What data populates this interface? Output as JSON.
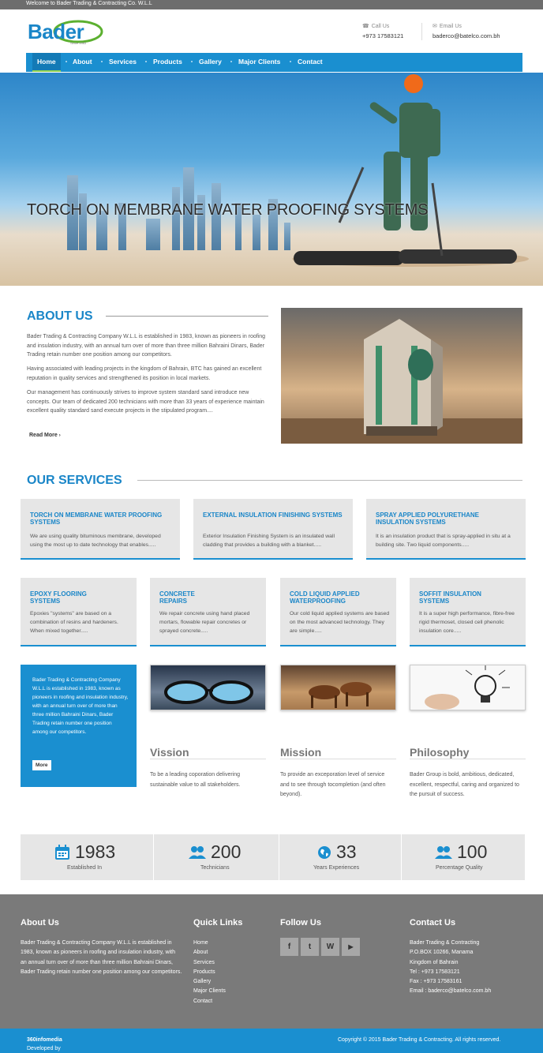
{
  "topbar": {
    "welcome": "Welcome to Bader Trading & Contracting Co. W.L.L"
  },
  "header": {
    "logo_text": "Bader",
    "logo_since": "Since 1983",
    "call_label": "Call Us",
    "call_value": "+973 17583121",
    "email_label": "Email Us",
    "email_value": "baderco@batelco.com.bh"
  },
  "nav": {
    "items": [
      "Home",
      "About",
      "Services",
      "Products",
      "Gallery",
      "Major Clients",
      "Contact"
    ]
  },
  "hero": {
    "title": "TORCH ON MEMBRANE WATER PROOFING SYSTEMS"
  },
  "about": {
    "title": "ABOUT US",
    "p1": "Bader Trading & Contracting Company W.L.L is established in 1983, known as pioneers in roofing and insulation industry, with an annual turn over of more than three million Bahraini Dinars, Bader Trading retain number one position among our competitors.",
    "p2": "Having associated with leading projects in the kingdom of Bahrain, BTC has gained an excellent reputation in quality services and strengthened its position in local markets.",
    "p3": "Our management has continuously strives to improve system standard sand introduce new concepts. Our team of dedicated 200 technicians with more than 33 years of experience maintain excellent quality standard sand execute projects in the stipulated program....",
    "read_more": "Read More"
  },
  "services": {
    "title": "OUR SERVICES",
    "row1": [
      {
        "title": "TORCH ON MEMBRANE WATER PROOFING SYSTEMS",
        "text": "We are using quality bituminous membrane, developed using the most up to date technology that enables....."
      },
      {
        "title": "EXTERNAL INSULATION FINISHING SYSTEMS",
        "text": "Exterior Insulation Finishing System is an insulated wall cladding that provides a building with a blanket....."
      },
      {
        "title": "SPRAY APPLIED POLYURETHANE INSULATION SYSTEMS",
        "text": "It is an insulation product that is spray-applied in situ at a building site. Two liquid components....."
      }
    ],
    "row2": [
      {
        "title": "EPOXY FLOORING SYSTEMS",
        "text": "Epoxies \"systems\" are based on a combination of resins and hardeners. When mixed together....."
      },
      {
        "title": "CONCRETE REPAIRS",
        "text": "We repair concrete using hand placed mortars, flowable repair concretes or sprayed concrete....."
      },
      {
        "title": "COLD LIQUID APPLIED WATERPROOFING",
        "text": "Our cold liquid applied systems are based on the most advanced technology. They are simple....."
      },
      {
        "title": "SOFFIT INSULATION SYSTEMS",
        "text": "It is a super high performance, fibre-free rigid thermoset, closed cell phenolic insulation core....."
      }
    ]
  },
  "intro_box": {
    "text": "Bader Trading & Contracting Company W.L.L is established in 1983, known as pioneers in roofing and insulation industry, with an annual turn over of more than three million Bahraini Dinars, Bader Trading retain number one position among our competitors.",
    "more": "More"
  },
  "vmp": [
    {
      "title": "Vission",
      "text": "To be a leading coporation delivering sustainable value to all stakeholders."
    },
    {
      "title": "Mission",
      "text": "To provide an exceporation level of service and to see through tocompletion (and often beyond)."
    },
    {
      "title": "Philosophy",
      "text": "Bader Group is bold, ambitious, dedicated, excellent, respectful, caring and organized to the pursuit of success."
    }
  ],
  "stats": [
    {
      "icon": "calendar-icon",
      "number": "1983",
      "label": "Established In"
    },
    {
      "icon": "users-icon",
      "number": "200",
      "label": "Technicians"
    },
    {
      "icon": "globe-icon",
      "number": "33",
      "label": "Years Experiences"
    },
    {
      "icon": "users-icon",
      "number": "100",
      "label": "Percentage Quality"
    }
  ],
  "footer": {
    "about_head": "About Us",
    "about_text": "Bader Trading & Contracting Company W.L.L is established in 1983, known as pioneers in roofing and insulation industry, with an annual turn over of more than three million Bahraini Dinars, Bader Trading retain number one position among our competitors.",
    "links_head": "Quick Links",
    "links": [
      "Home",
      "About",
      "Services",
      "Products",
      "Gallery",
      "Major Clients",
      "Contact"
    ],
    "follow_head": "Follow Us",
    "social": [
      {
        "icon": "facebook-icon",
        "glyph": "f"
      },
      {
        "icon": "twitter-icon",
        "glyph": "t"
      },
      {
        "icon": "wordpress-icon",
        "glyph": "W"
      },
      {
        "icon": "youtube-icon",
        "glyph": "▶"
      }
    ],
    "contact_head": "Contact Us",
    "contact_lines": [
      "Bader Trading & Contracting",
      "P.O.BOX 10266, Manama",
      "Kingdom of Bahrain",
      "Tel : +973 17583121",
      "Fax : +973 17583161",
      "Email : baderco@batelco.com.bh"
    ]
  },
  "bottombar": {
    "developed_prefix": "Developed by ",
    "developer": "360infomedia",
    "copyright": "Copyright © 2015 Bader Trading & Contracting. All rights reserved."
  },
  "colors": {
    "brand_blue": "#1a8fd0",
    "accent_green": "#8fd14f",
    "footer_gray": "#7a7a7a"
  }
}
